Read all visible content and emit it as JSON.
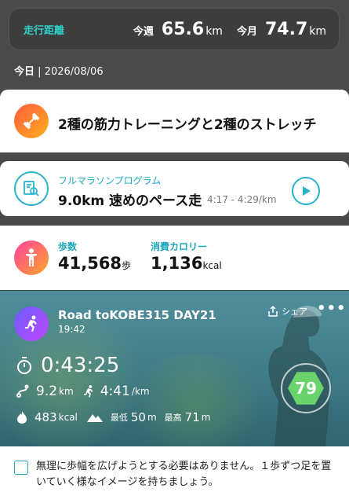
{
  "distance": {
    "label": "走行距離",
    "week_label": "今週",
    "week_value": "65.6",
    "week_unit": "km",
    "month_label": "今月",
    "month_value": "74.7",
    "month_unit": "km"
  },
  "today": {
    "label": "今日",
    "date": "2026/08/06"
  },
  "training": {
    "text": "2種の筋力トレーニングと2種のストレッチ"
  },
  "program": {
    "sub": "フルマラソンプログラム",
    "title": "9.0km 速めのペース走",
    "pace": "4:17 - 4:29/km"
  },
  "stats": {
    "steps_label": "歩数",
    "steps_value": "41,568",
    "steps_unit": "歩",
    "cal_label": "消費カロリー",
    "cal_value": "1,136",
    "cal_unit": "kcal"
  },
  "workout": {
    "title": "Road toKOBE315 DAY21",
    "time": "19:42",
    "share_label": "シェア",
    "duration": "0:43:25",
    "distance": "9.2",
    "distance_unit": "km",
    "pace": "4:41",
    "pace_unit": "/km",
    "calories": "483",
    "calories_unit": "kcal",
    "min_label": "最低",
    "min_value": "50",
    "min_unit": "m",
    "max_label": "最高",
    "max_value": "71",
    "max_unit": "m",
    "score": "79"
  },
  "advice": {
    "text": "無理に歩幅を広げようとする必要はありません。１歩ずつ足を置いていく様なイメージを持ちましょう。"
  },
  "colors": {
    "accent": "#25b4c9",
    "score": "#6bd36b"
  }
}
